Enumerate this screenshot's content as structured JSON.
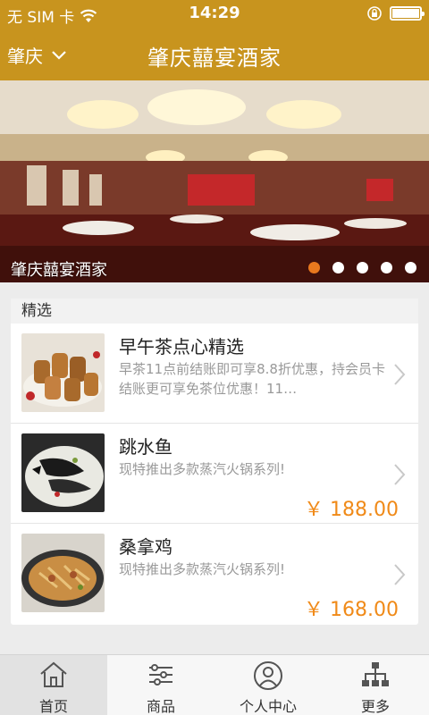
{
  "status_bar": {
    "carrier": "无 SIM 卡",
    "time": "14:29"
  },
  "nav": {
    "city": "肇庆",
    "title": "肇庆囍宴酒家"
  },
  "banner": {
    "caption": "肇庆囍宴酒家",
    "dot_count": 5,
    "active_dot": 0
  },
  "section": {
    "title": "精选"
  },
  "items": [
    {
      "name": "早午茶点心精选",
      "desc": "早茶11点前结账即可享8.8折优惠，持会员卡结账更可享免茶位优惠！11…",
      "price": ""
    },
    {
      "name": "跳水鱼",
      "desc": "现特推出多款蒸汽火锅系列!",
      "price": "￥ 188.00"
    },
    {
      "name": "桑拿鸡",
      "desc": "现特推出多款蒸汽火锅系列!",
      "price": "￥ 168.00"
    }
  ],
  "tabs": [
    {
      "label": "首页",
      "icon": "home-icon"
    },
    {
      "label": "商品",
      "icon": "list-icon"
    },
    {
      "label": "个人中心",
      "icon": "user-icon"
    },
    {
      "label": "更多",
      "icon": "sitemap-icon"
    }
  ],
  "colors": {
    "brand": "#c8941e",
    "price": "#f08a18",
    "active_dot": "#e8781e"
  }
}
